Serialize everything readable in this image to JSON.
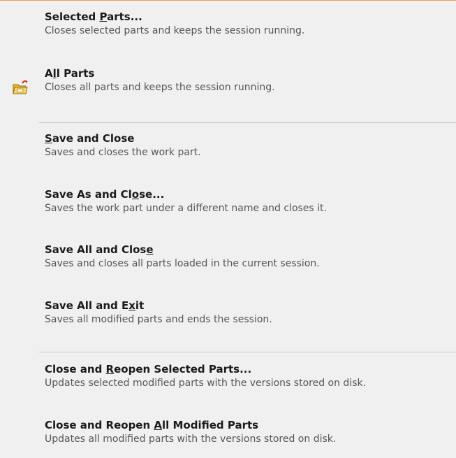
{
  "menu": {
    "items": [
      {
        "title_pre": "Selected ",
        "title_key": "P",
        "title_post": "arts...",
        "desc": "Closes selected parts and keeps the session running."
      },
      {
        "title_pre": "A",
        "title_key": "l",
        "title_post": "l Parts",
        "desc": "Closes all parts and keeps the session running.",
        "icon": "folder-close-icon"
      },
      {
        "title_pre": "",
        "title_key": "S",
        "title_post": "ave and Close",
        "desc": "Saves and closes the work part."
      },
      {
        "title_pre": "Save As and Cl",
        "title_key": "o",
        "title_post": "se...",
        "desc": "Saves the work part under a different name and closes it."
      },
      {
        "title_pre": "Save All and Clos",
        "title_key": "e",
        "title_post": "",
        "desc": "Saves and closes all parts loaded in the current session."
      },
      {
        "title_pre": "Save All and E",
        "title_key": "x",
        "title_post": "it",
        "desc": "Saves all modified parts and ends the session."
      },
      {
        "title_pre": "Close and ",
        "title_key": "R",
        "title_post": "eopen Selected Parts...",
        "desc": "Updates selected modified parts with the versions stored on disk."
      },
      {
        "title_pre": "Close and Reopen ",
        "title_key": "A",
        "title_post": "ll Modified Parts",
        "desc": "Updates all modified parts with the versions stored on disk."
      }
    ]
  },
  "colors": {
    "background": "#f0f0f0",
    "separator": "#c8c8c8",
    "accent_border": "#e8a060"
  }
}
